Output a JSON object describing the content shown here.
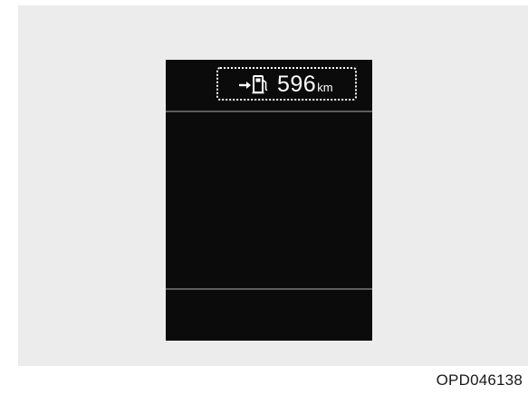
{
  "display": {
    "distance_to_empty": {
      "icon": "fuel-pump-icon",
      "value": "596",
      "unit": "km"
    }
  },
  "caption": "OPD046138"
}
